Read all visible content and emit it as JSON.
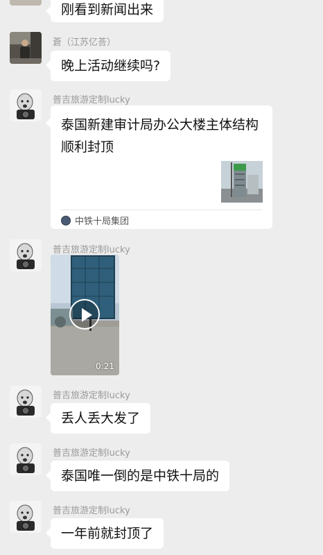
{
  "messages": [
    {
      "text": "刚看到新闻出来"
    },
    {
      "sender": "蒼（江苏亿荅）",
      "text": "晚上活动继续吗?"
    },
    {
      "sender": "普吉旅游定制lucky",
      "link_card": {
        "title": "泰国新建审计局办公大楼主体结构顺利封顶",
        "source": "中铁十局集团"
      }
    },
    {
      "sender": "普吉旅游定制lucky",
      "video": {
        "duration": "0:21"
      }
    },
    {
      "sender": "普吉旅游定制lucky",
      "text": "丢人丢大发了"
    },
    {
      "sender": "普吉旅游定制lucky",
      "text": "泰国唯一倒的是中铁十局的"
    },
    {
      "sender": "普吉旅游定制lucky",
      "text": "一年前就封顶了"
    }
  ],
  "colors": {
    "background": "#ededed",
    "bubble": "#ffffff",
    "sender_text": "#9a9a9a"
  }
}
